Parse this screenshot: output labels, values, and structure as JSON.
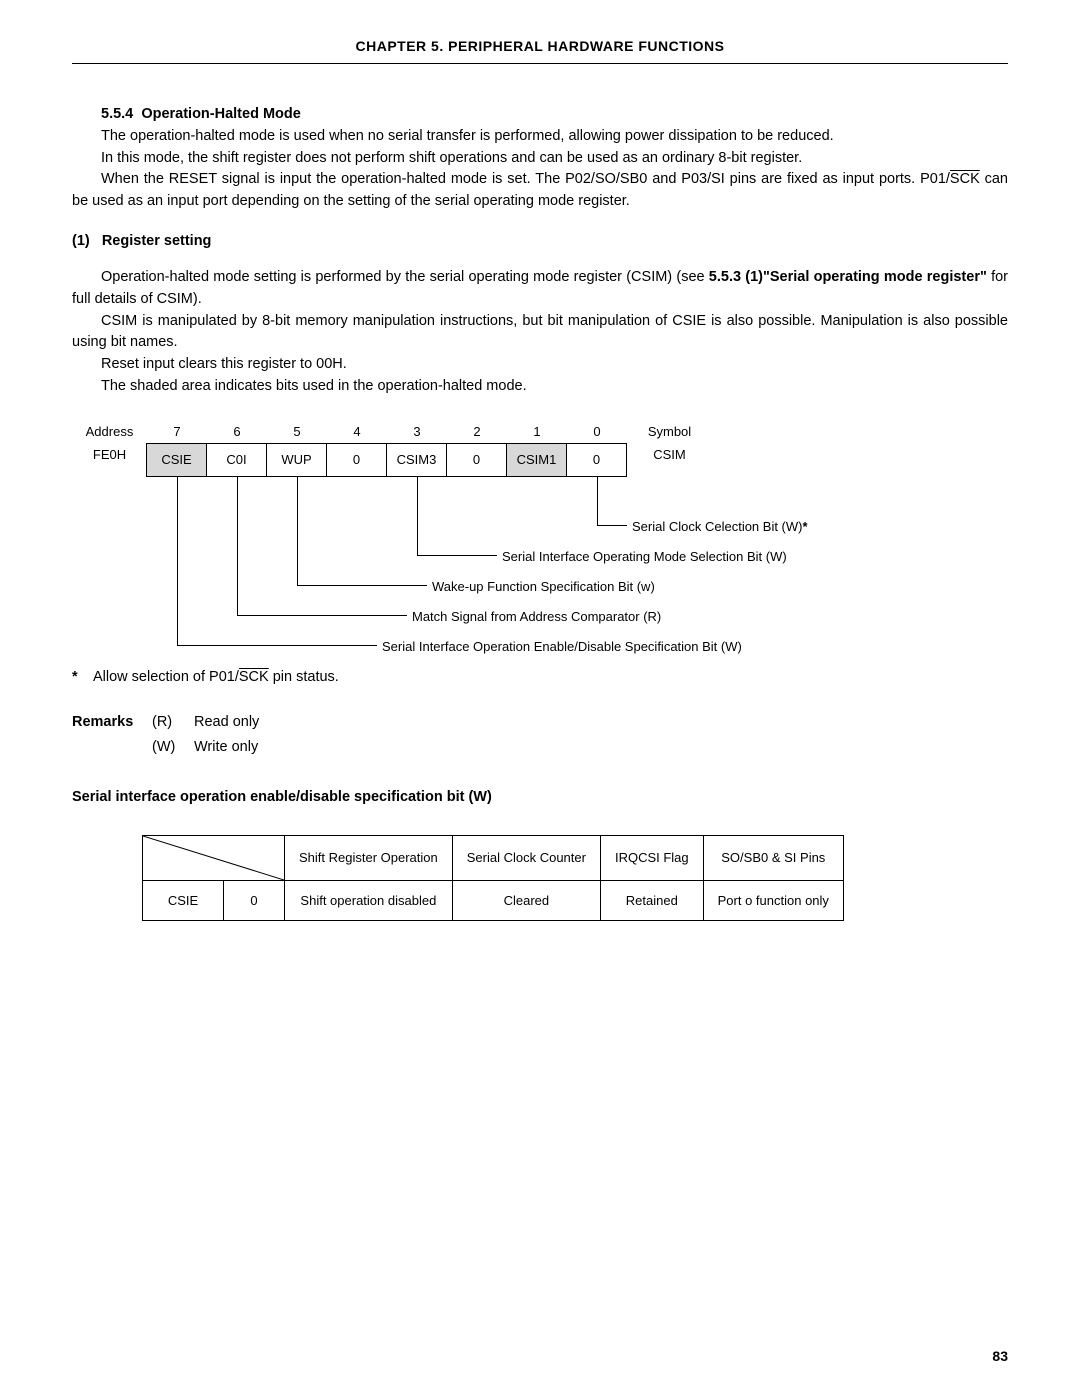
{
  "chapter_header": "CHAPTER 5.  PERIPHERAL  HARDWARE  FUNCTIONS",
  "section_no": "5.5.4",
  "section_title": "Operation-Halted Mode",
  "p1": "The operation-halted mode is used when no serial transfer is performed, allowing power dissipation to be reduced.",
  "p2": "In this mode, the shift register does not perform shift operations and can be used as an ordinary 8-bit register.",
  "p3a": "When the RESET signal is input the operation-halted mode is set. The P02/SO/SB0 and P03/SI pins are fixed as input ports. P01/",
  "p3_sck": "SCK",
  "p3b": " can be used as an input port depending on the setting of the serial operating mode register.",
  "sub1_no": "(1)",
  "sub1_title": "Register setting",
  "p4a": "Operation-halted mode setting is performed by the serial operating mode register (CSIM) (see ",
  "p4_ref": "5.5.3 (1)\"Serial operating mode register\"",
  "p4b": " for full details of CSIM).",
  "p5": "CSIM is manipulated by 8-bit memory manipulation instructions, but bit manipulation of CSIE is also possible. Manipulation is also possible using bit names.",
  "p6": "Reset input clears this register to 00H.",
  "p7": "The shaded area indicates bits used in the operation-halted mode.",
  "reg": {
    "address_label": "Address",
    "symbol_label": "Symbol",
    "address_value": "FE0H",
    "symbol_value": "CSIM",
    "idx": [
      "7",
      "6",
      "5",
      "4",
      "3",
      "2",
      "1",
      "0"
    ],
    "bits": [
      "CSIE",
      "C0I",
      "WUP",
      "0",
      "CSIM3",
      "0",
      "CSIM1",
      "0"
    ]
  },
  "descs": {
    "d0": "Serial Clock Celection Bit (W)",
    "d0_star": "*",
    "d3": "Serial Interface Operating Mode Selection Bit (W)",
    "d5": "Wake-up Function Specification Bit (w)",
    "d6": "Match Signal from Address Comparator (R)",
    "d7": "Serial Interface Operation Enable/Disable Specification Bit (W)"
  },
  "footnote_star": "*",
  "footnote_a": "Allow selection of P01/",
  "footnote_sck": "SCK",
  "footnote_b": " pin status.",
  "remarks": {
    "label": "Remarks",
    "r_code": "(R)",
    "r_text": "Read only",
    "w_code": "(W)",
    "w_text": "Write only"
  },
  "table_title": "Serial interface operation enable/disable specification bit (W)",
  "csie_table": {
    "h1": "Shift Register Operation",
    "h2": "Serial Clock Counter",
    "h3": "IRQCSI Flag",
    "h4": "SO/SB0 & SI Pins",
    "rlabel": "CSIE",
    "rval": "0",
    "c1": "Shift operation disabled",
    "c2": "Cleared",
    "c3": "Retained",
    "c4": "Port o function only"
  },
  "page_no": "83"
}
